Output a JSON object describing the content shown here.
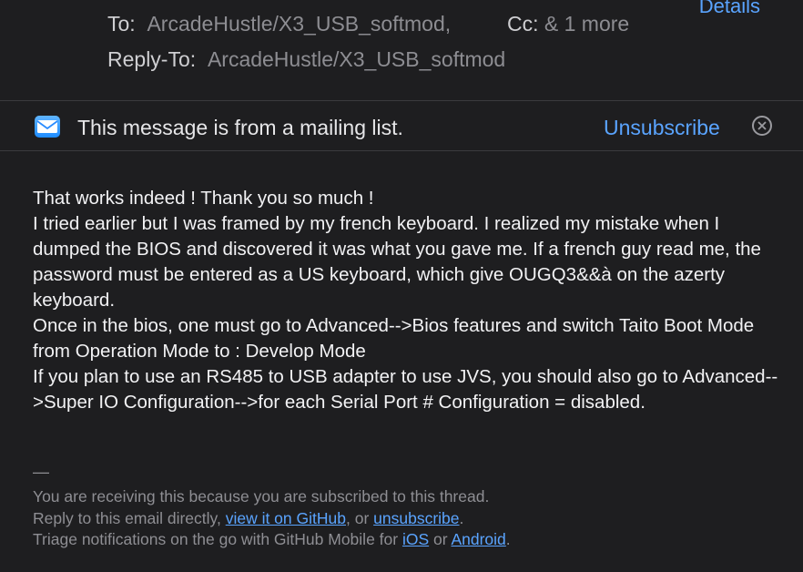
{
  "header": {
    "to_label": "To:",
    "to_value": "ArcadeHustle/X3_USB_softmod,",
    "cc_label": "Cc:",
    "cc_value": "& 1 more",
    "reply_to_label": "Reply-To:",
    "reply_to_value": "ArcadeHustle/X3_USB_softmod",
    "details_link": "Details"
  },
  "mailing_list": {
    "icon": "envelope-icon",
    "text": "This message is from a mailing list.",
    "unsubscribe": "Unsubscribe",
    "close_icon": "close-circle-icon"
  },
  "body": {
    "lines": [
      "That works indeed ! Thank you so much !",
      "I tried earlier but I was framed by my french keyboard. I realized my mistake when I dumped the BIOS and discovered it was what you gave me. If a french guy read me, the password must be entered as a US keyboard, which give OUGQ3&&à on the azerty keyboard.",
      "Once in the bios, one must go to Advanced-->Bios features and switch Taito Boot Mode from Operation Mode to : Develop Mode",
      "If you plan to use an RS485 to USB adapter to use JVS, you should also go to Advanced-->Super IO Configuration-->for each Serial Port # Configuration = disabled."
    ]
  },
  "footer": {
    "dash": "—",
    "line1": "You are receiving this because you are subscribed to this thread.",
    "line2_prefix": "Reply to this email directly, ",
    "line2_link1": "view it on GitHub",
    "line2_mid": ", or ",
    "line2_link2": "unsubscribe",
    "line2_suffix": ".",
    "line3_prefix": "Triage notifications on the go with GitHub Mobile for ",
    "line3_link1": "iOS",
    "line3_mid": " or ",
    "line3_link2": "Android",
    "line3_suffix": "."
  },
  "colors": {
    "background": "#1e1e20",
    "link": "#5aa4ff",
    "muted": "#8d8d92"
  }
}
